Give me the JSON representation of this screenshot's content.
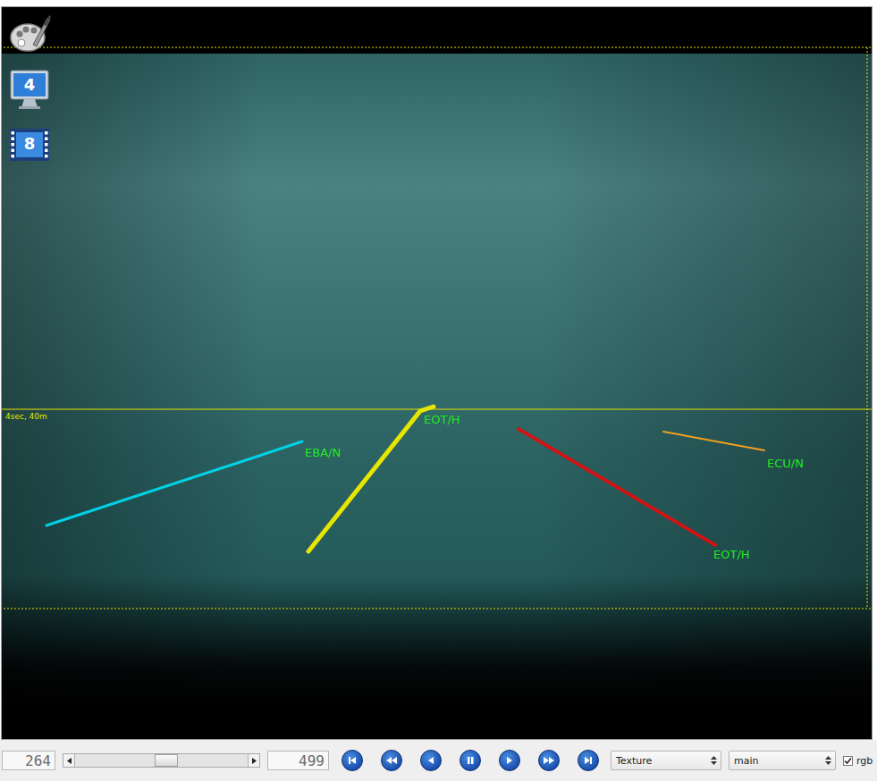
{
  "viewer": {
    "sidebar_icons": [
      {
        "name": "palette",
        "label": ""
      },
      {
        "name": "monitor",
        "label": "4"
      },
      {
        "name": "film",
        "label": "8"
      }
    ],
    "horizon_label": "4sec, 40m",
    "lanes": [
      {
        "label": "EBA/N",
        "color": "#00d2e6"
      },
      {
        "label": "EOT/H",
        "color": "#e6e600"
      },
      {
        "label": "EOT/H",
        "color": "#d01414"
      },
      {
        "label": "ECU/N",
        "color": "#f0a020"
      }
    ]
  },
  "toolbar": {
    "frame": "264",
    "slider": {
      "level": 0.53
    },
    "total": "499",
    "selects": [
      {
        "value": "Texture"
      },
      {
        "value": "main"
      }
    ],
    "checkbox": {
      "label": "rgb",
      "checked": true
    }
  }
}
